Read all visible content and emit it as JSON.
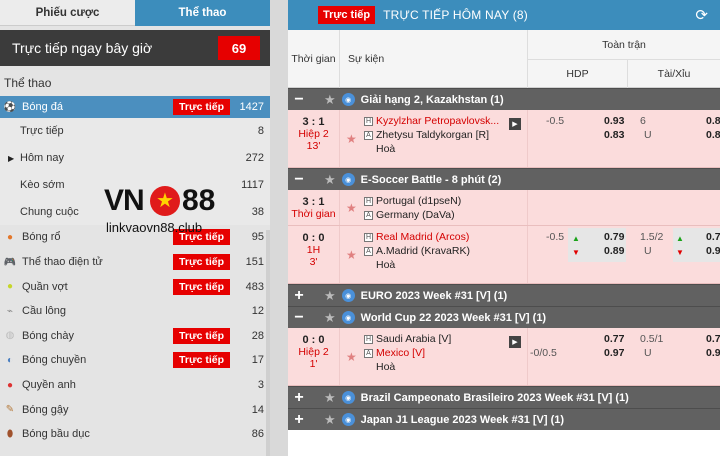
{
  "sidebar": {
    "tabs": [
      {
        "label": "Phiếu cược",
        "active": false
      },
      {
        "label": "Thể thao",
        "active": true
      }
    ],
    "live_now": {
      "label": "Trực tiếp ngay bây giờ",
      "count": "69"
    },
    "section_title": "Thể thao",
    "sports": [
      {
        "label": "Bóng đá",
        "badge": "Trực tiếp",
        "count": "1427",
        "icon": "soccer-ball-icon",
        "type": "main"
      },
      {
        "label": "Trực tiếp",
        "badge": "",
        "count": "8",
        "icon": "",
        "type": "sub"
      },
      {
        "label": "Hôm nay",
        "badge": "",
        "count": "272",
        "icon": "caret-right-icon",
        "type": "sub"
      },
      {
        "label": "Kèo sớm",
        "badge": "",
        "count": "1117",
        "icon": "",
        "type": "sub"
      },
      {
        "label": "Chung cuộc",
        "badge": "",
        "count": "38",
        "icon": "",
        "type": "sub"
      },
      {
        "label": "Bóng rổ",
        "badge": "Trực tiếp",
        "count": "95",
        "icon": "basketball-icon",
        "type": "sport"
      },
      {
        "label": "Thể thao điện tử",
        "badge": "Trực tiếp",
        "count": "151",
        "icon": "gamepad-icon",
        "type": "sport"
      },
      {
        "label": "Quần vợt",
        "badge": "Trực tiếp",
        "count": "483",
        "icon": "tennis-ball-icon",
        "type": "sport"
      },
      {
        "label": "Cầu lông",
        "badge": "",
        "count": "12",
        "icon": "shuttlecock-icon",
        "type": "sport"
      },
      {
        "label": "Bóng chày",
        "badge": "Trực tiếp",
        "count": "28",
        "icon": "baseball-icon",
        "type": "sport"
      },
      {
        "label": "Bóng chuyền",
        "badge": "Trực tiếp",
        "count": "17",
        "icon": "volleyball-icon",
        "type": "sport"
      },
      {
        "label": "Quyền anh",
        "badge": "",
        "count": "3",
        "icon": "boxing-glove-icon",
        "type": "sport"
      },
      {
        "label": "Bóng gậy",
        "badge": "",
        "count": "14",
        "icon": "cricket-icon",
        "type": "sport"
      },
      {
        "label": "Bóng bầu dục",
        "badge": "",
        "count": "86",
        "icon": "rugby-ball-icon",
        "type": "sport"
      }
    ],
    "watermark": {
      "brand_left": "VN",
      "brand_right": "88",
      "site": "linkvaovn88.club"
    }
  },
  "main": {
    "title_badge": "Trực tiếp",
    "title": "TRỰC TIẾP HÔM NAY (8)",
    "headers": {
      "time": "Thời gian",
      "event": "Sự kiện",
      "full_match": "Toàn trận",
      "hdp": "HDP",
      "ou": "Tài/Xỉu"
    },
    "leagues": [
      {
        "toggle": "−",
        "name": "Giải hạng 2, Kazakhstan (1)",
        "matches": [
          {
            "score": "3 : 1",
            "period": "Hiệp 2",
            "minute": "13'",
            "home": "Kyzylzhar Petropavlovsk...",
            "away": "Zhetysu Taldykorgan [R]",
            "draw": "Hoà",
            "home_fav": true,
            "away_fav": false,
            "tv": true,
            "hdp_line": "-0.5",
            "hdp_home": "0.93",
            "hdp_away": "0.83",
            "ou_line": "6",
            "ou_u": "U",
            "ou_over": "0.8",
            "ou_under": "0.8"
          }
        ]
      },
      {
        "toggle": "−",
        "name": "E-Soccer Battle - 8 phút (2)",
        "matches": [
          {
            "score": "3 : 1",
            "period": "Thời gian",
            "minute": "",
            "home": "Portugal (d1pseN)",
            "away": "Germany (DaVa)",
            "draw": "",
            "home_fav": false,
            "away_fav": false,
            "tv": false,
            "hdp_line": "",
            "hdp_home": "",
            "hdp_away": "",
            "ou_line": "",
            "ou_u": "",
            "ou_over": "",
            "ou_under": ""
          },
          {
            "score": "0 : 0",
            "period": "1H",
            "minute": "3'",
            "home": "Real Madrid (Arcos)",
            "away": "A.Madrid (KravaRK)",
            "draw": "Hoà",
            "home_fav": true,
            "away_fav": false,
            "tv": false,
            "hdp_line": "-0.5",
            "hdp_home": "0.79",
            "hdp_away": "0.89",
            "ou_line": "1.5/2",
            "ou_u": "U",
            "ou_over": "0.7",
            "ou_under": "0.9"
          }
        ]
      },
      {
        "toggle": "+",
        "name": "EURO 2023 Week #31 [V] (1)",
        "matches": []
      },
      {
        "toggle": "−",
        "name": "World Cup 22 2023 Week #31 [V] (1)",
        "matches": [
          {
            "score": "0 : 0",
            "period": "Hiệp 2",
            "minute": "1'",
            "home": "Saudi Arabia [V]",
            "away": "Mexico [V]",
            "draw": "Hoà",
            "home_fav": false,
            "away_fav": true,
            "tv": true,
            "hdp_line": "-0/0.5",
            "hdp_home": "0.77",
            "hdp_away": "0.97",
            "ou_line": "0.5/1",
            "ou_u": "U",
            "ou_over": "0.7",
            "ou_under": "0.9"
          }
        ]
      },
      {
        "toggle": "+",
        "name": "Brazil Campeonato Brasileiro 2023 Week #31 [V] (1)",
        "matches": []
      },
      {
        "toggle": "+",
        "name": "Japan J1 League 2023 Week #31 [V] (1)",
        "matches": []
      }
    ]
  },
  "colors": {
    "accent_blue": "#3c8dbc",
    "live_red": "#e60000",
    "league_bar": "#616161",
    "match_bg": "#fbdcdc"
  }
}
